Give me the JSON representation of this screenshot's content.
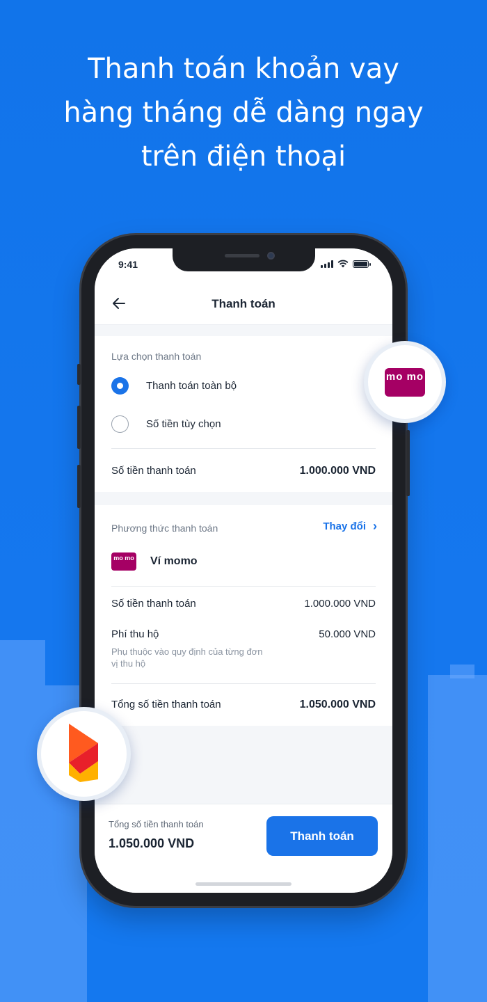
{
  "headline": {
    "line1": "Thanh toán khoản vay",
    "line2": "hàng tháng dễ dàng ngay",
    "line3": "trên điện thoại"
  },
  "status_bar": {
    "time": "9:41"
  },
  "app_bar": {
    "title": "Thanh toán",
    "back_icon": "arrow-left-icon"
  },
  "payment_options": {
    "section_label": "Lựa chọn thanh toán",
    "options": [
      {
        "label": "Thanh toán toàn bộ",
        "selected": true
      },
      {
        "label": "Số tiền tùy chọn",
        "selected": false
      }
    ],
    "amount_label": "Số tiền thanh toán",
    "amount_value": "1.000.000 VND"
  },
  "payment_method": {
    "section_label": "Phương thức thanh toán",
    "change_label": "Thay đổi",
    "wallet_logo_text": "mo mo",
    "wallet_name": "Ví momo",
    "rows": [
      {
        "label": "Số tiền thanh toán",
        "value": "1.000.000 VND"
      },
      {
        "label": "Phí thu hộ",
        "value": "50.000 VND",
        "note": "Phụ thuộc vào quy định của từng đơn vị thu hộ"
      }
    ],
    "total_label": "Tổng số tiền thanh toán",
    "total_value": "1.050.000 VND"
  },
  "bottom_bar": {
    "total_label": "Tổng số tiền thanh toán",
    "total_value": "1.050.000 VND",
    "pay_button": "Thanh toán"
  },
  "badges": {
    "momo_text": "mo mo",
    "momo_color": "#a50064",
    "brand_logo_colors": [
      "#ff5a1f",
      "#ffb000",
      "#e8202a"
    ]
  },
  "colors": {
    "background": "#1273ea",
    "accent": "#1a73e8"
  }
}
